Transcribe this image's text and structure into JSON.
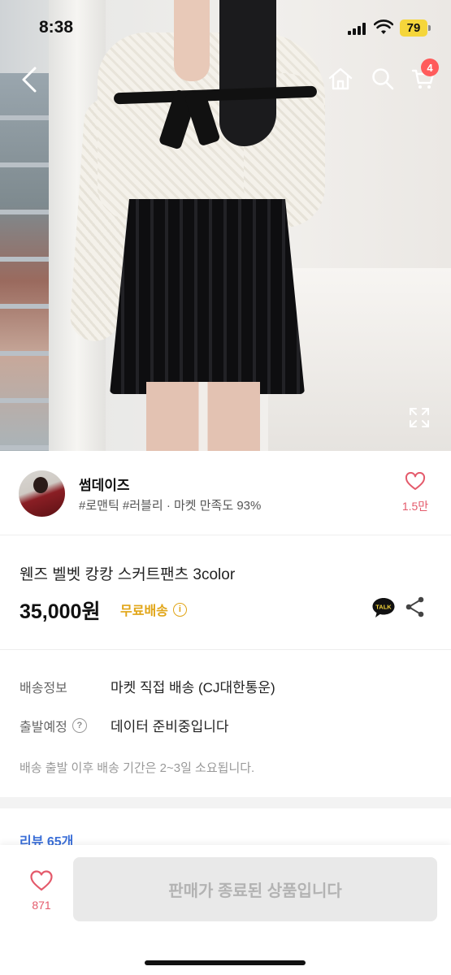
{
  "status_bar": {
    "time": "8:38",
    "battery": "79"
  },
  "nav": {
    "back_icon": "chevron-left-icon",
    "home_icon": "home-icon",
    "search_icon": "search-icon",
    "cart_icon": "cart-icon",
    "cart_badge": "4"
  },
  "seller": {
    "name": "썸데이즈",
    "meta": "#로맨틱 #러블리 · 마켓 만족도 93%",
    "favorite_count": "1.5만"
  },
  "product": {
    "title": "웬즈 벨벳 캉캉 스커트팬츠 3color",
    "price": "35,000원",
    "shipping_badge": "무료배송",
    "talk_label": "TALK"
  },
  "shipping": {
    "rows": [
      {
        "label": "배송정보",
        "value": "마켓 직접 배송 (CJ대한통운)"
      },
      {
        "label": "출발예정",
        "value": "데이터 준비중입니다"
      }
    ],
    "note": "배송 출발 이후 배송 기간은 2~3일 소요됩니다."
  },
  "reviews": {
    "label": "리뷰 65개"
  },
  "bottom_bar": {
    "favorite_count": "871",
    "status_button": "판매가 종료된 상품입니다"
  },
  "colors": {
    "accent_pink": "#e45a6b",
    "free_shipping": "#e1a517",
    "badge_red": "#ff5b5b",
    "link_blue": "#3b6fd8"
  }
}
